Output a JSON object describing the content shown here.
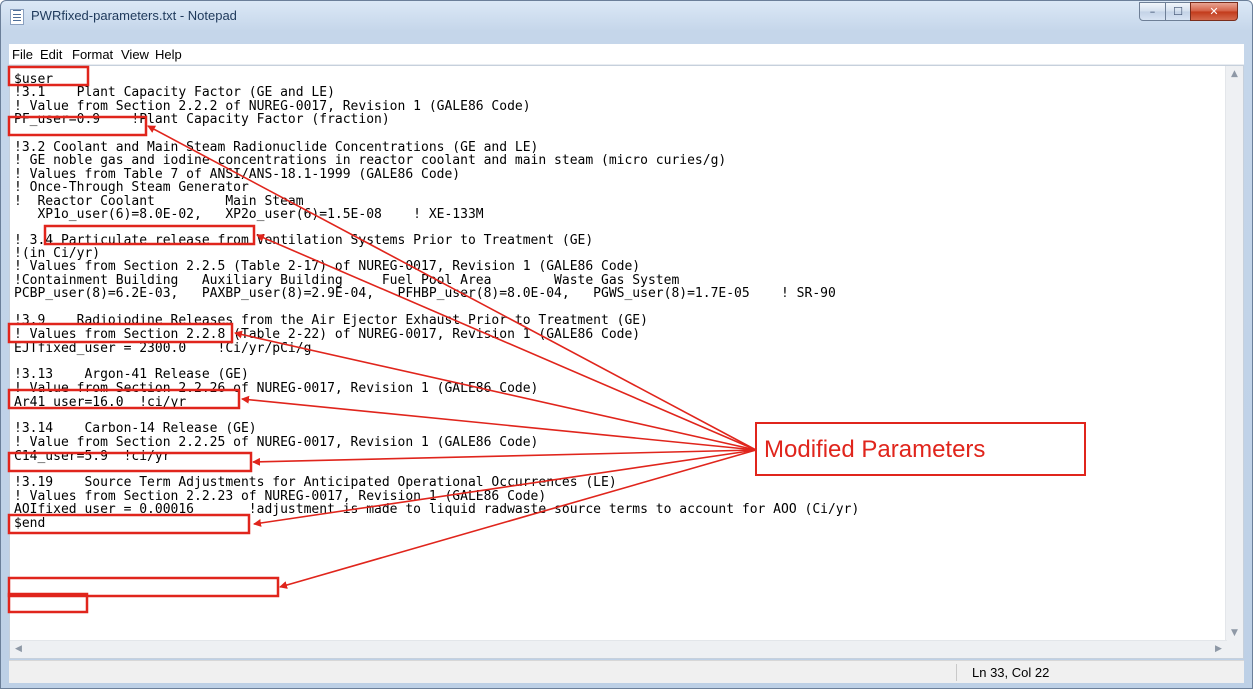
{
  "window": {
    "title": "PWRfixed-parameters.txt - Notepad",
    "icon": "notepad-icon",
    "controls": {
      "minimize": "–",
      "maximize": "☐",
      "close": "✕"
    }
  },
  "menu": [
    "File",
    "Edit",
    "Format",
    "View",
    "Help"
  ],
  "document": {
    "lines": [
      "$user",
      "!3.1    Plant Capacity Factor (GE and LE)",
      "! Value from Section 2.2.2 of NUREG-0017, Revision 1 (GALE86 Code)",
      "PF_user=0.9    !Plant Capacity Factor (fraction)",
      "",
      "!3.2 Coolant and Main Steam Radionuclide Concentrations (GE and LE)",
      "! GE noble gas and iodine concentrations in reactor coolant and main steam (micro curies/g)",
      "! Values from Table 7 of ANSI/ANS-18.1-1999 (GALE86 Code)",
      "! Once-Through Steam Generator",
      "!  Reactor Coolant         Main Steam",
      "   XP1o_user(6)=8.0E-02,   XP2o_user(6)=1.5E-08    ! XE-133M",
      "",
      "! 3.4 Particulate release from Ventilation Systems Prior to Treatment (GE)",
      "!(in Ci/yr)",
      "! Values from Section 2.2.5 (Table 2-17) of NUREG-0017, Revision 1 (GALE86 Code)",
      "!Containment Building   Auxiliary Building     Fuel Pool Area        Waste Gas System",
      "PCBP_user(8)=6.2E-03,   PAXBP_user(8)=2.9E-04,   PFHBP_user(8)=8.0E-04,   PGWS_user(8)=1.7E-05    ! SR-90",
      "",
      "!3.9    Radioiodine Releases from the Air Ejector Exhaust Prior to Treatment (GE)",
      "! Values from Section 2.2.8 (Table 2-22) of NUREG-0017, Revision 1 (GALE86 Code)",
      "EJTfixed_user = 2300.0    !Ci/yr/pCi/g",
      "",
      "!3.13    Argon-41 Release (GE)",
      "! Value from Section 2.2.26 of NUREG-0017, Revision 1 (GALE86 Code)",
      "Ar41_user=16.0  !ci/yr",
      "",
      "!3.14    Carbon-14 Release (GE)",
      "! Value from Section 2.2.25 of NUREG-0017, Revision 1 (GALE86 Code)",
      "C14_user=5.9  !ci/yr",
      "",
      "!3.19    Source Term Adjustments for Anticipated Operational Occurrences (LE)",
      "! Values from Section 2.2.23 of NUREG-0017, Revision 1 (GALE86 Code)",
      "AOIfixed_user = 0.00016       !adjustment is made to liquid radwaste source terms to account for AOO (Ci/yr)",
      "$end"
    ]
  },
  "status": {
    "position": "Ln 33, Col 22"
  },
  "annotation": {
    "label": "Modified Parameters",
    "color": "#e0251c"
  }
}
